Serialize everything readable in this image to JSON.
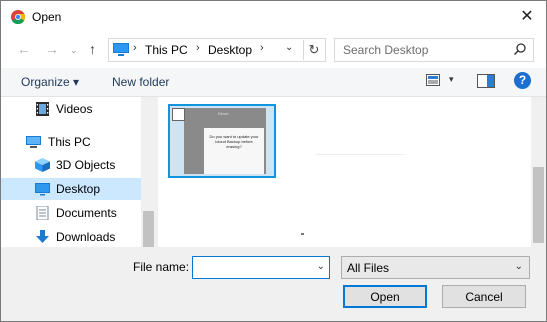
{
  "window": {
    "title": "Open",
    "close_glyph": "✕",
    "app_icon": "chrome-icon"
  },
  "nav": {
    "back_glyph": "←",
    "forward_glyph": "→",
    "up_glyph": "↑"
  },
  "address": {
    "breadcrumbs": [
      "This PC",
      "Desktop"
    ],
    "separator": "›",
    "dropdown_glyph": "⌄",
    "refresh_glyph": "↻"
  },
  "search": {
    "placeholder": "Search Desktop"
  },
  "toolbar": {
    "organize_label": "Organize ▾",
    "new_folder_label": "New folder",
    "view_dropdown_glyph": "▾",
    "help_label": "?"
  },
  "sidebar": {
    "items": [
      {
        "label": "Videos",
        "icon": "film-icon"
      },
      {
        "label": "This PC",
        "icon": "computer-icon"
      },
      {
        "label": "3D Objects",
        "icon": "cube-icon"
      },
      {
        "label": "Desktop",
        "icon": "desktop-icon",
        "selected": true
      },
      {
        "label": "Documents",
        "icon": "document-icon"
      },
      {
        "label": "Downloads",
        "icon": "download-icon"
      }
    ]
  },
  "content": {
    "files": [
      {
        "thumbnail": "screenshot thumbnail",
        "selected": true
      }
    ],
    "thumbnail_text": [
      "Reset",
      "Do you want to update your",
      "Icloud Backup before",
      "erasing?"
    ]
  },
  "footer": {
    "file_name_label": "File name:",
    "file_name_value": "",
    "file_name_dropdown_glyph": "⌄",
    "file_type_value": "All Files",
    "file_type_dropdown_glyph": "⌄",
    "open_label": "Open",
    "cancel_label": "Cancel"
  },
  "colors": {
    "accent": "#0078d7",
    "selection": "#cce8ff",
    "help": "#1c6fd1"
  }
}
